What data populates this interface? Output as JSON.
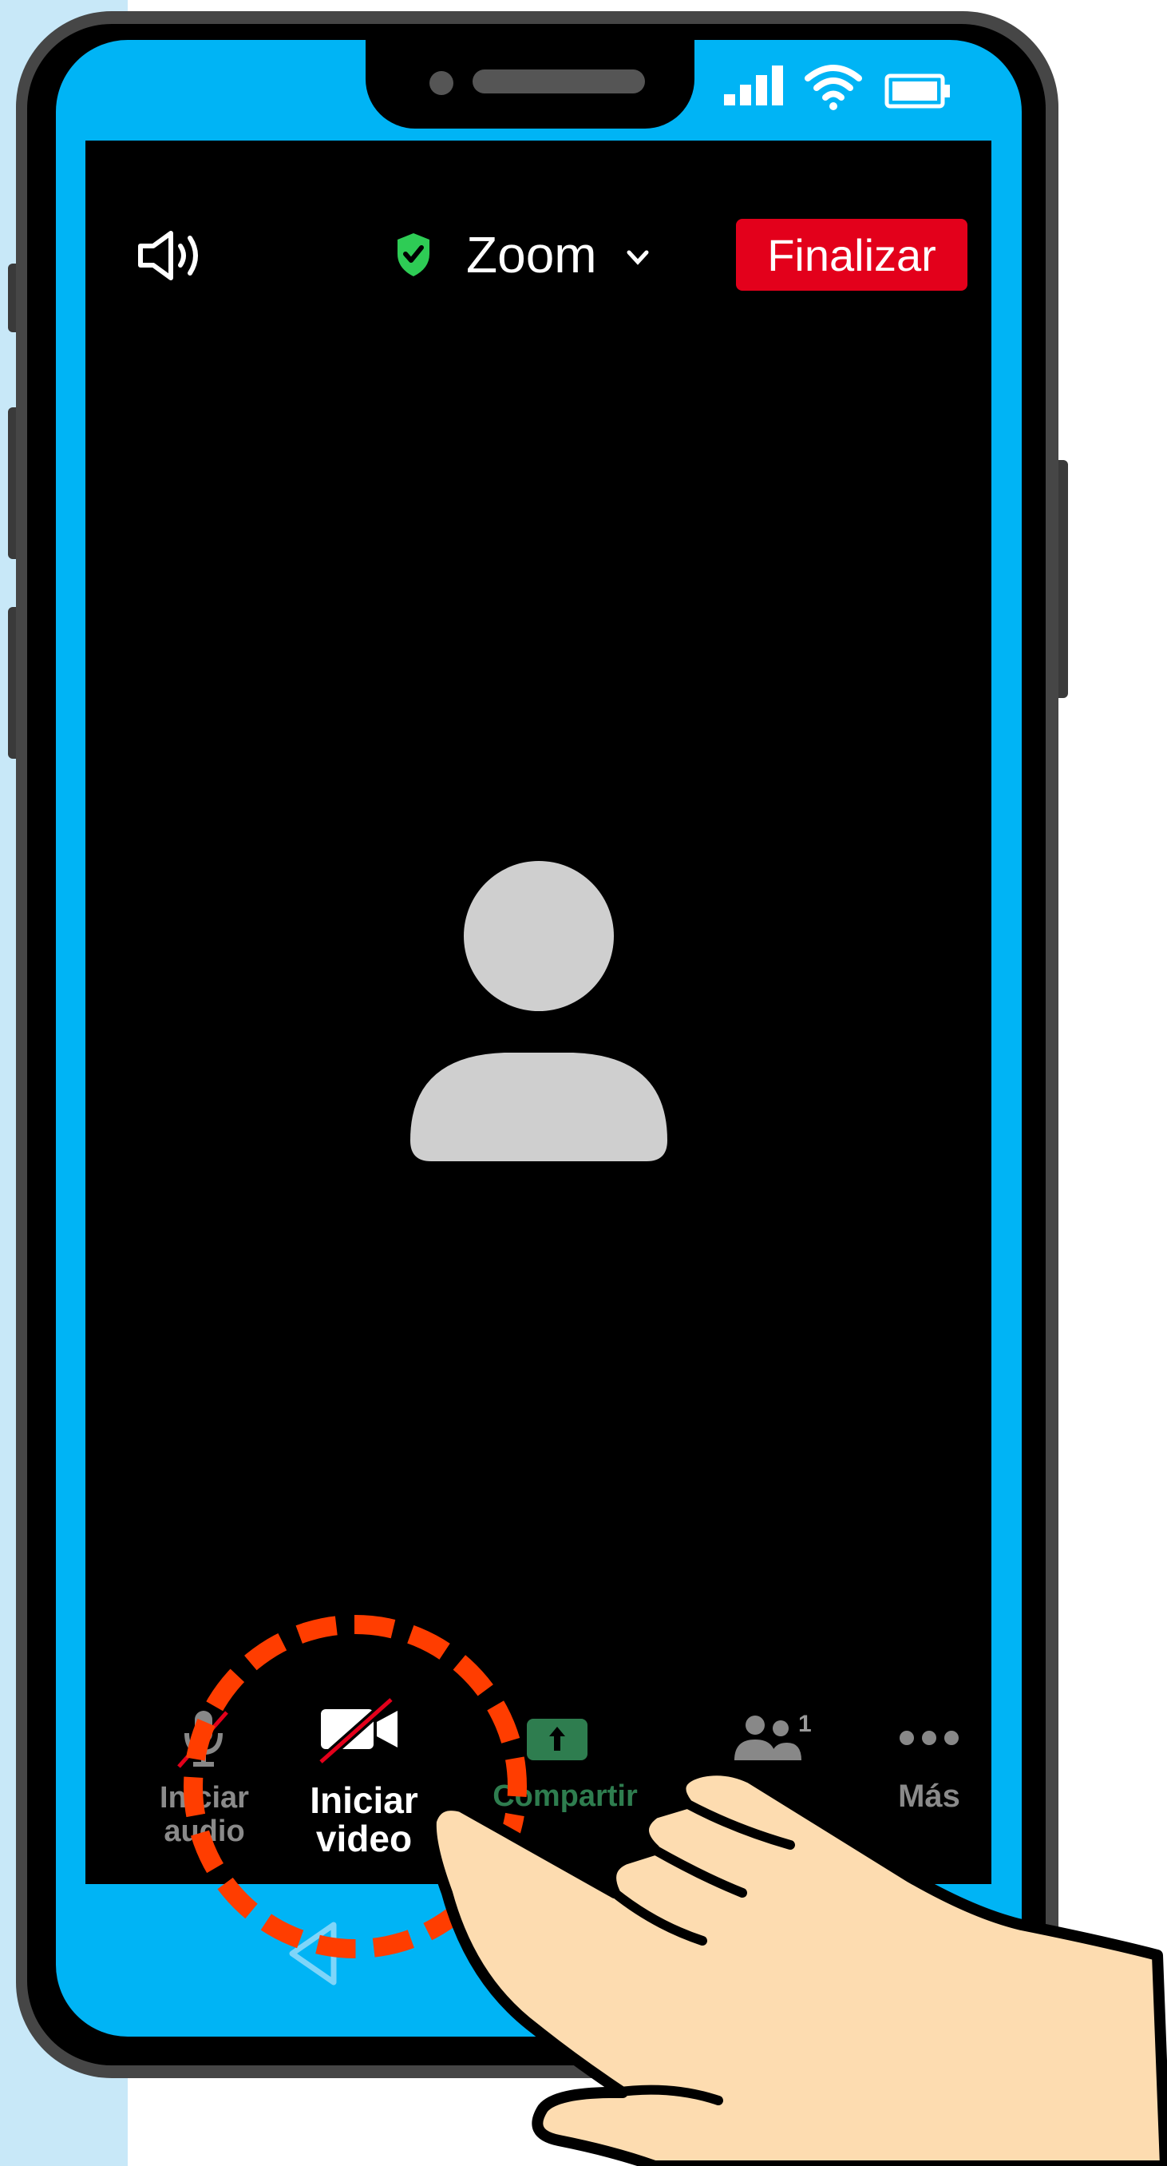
{
  "meeting_header": {
    "app_name": "Zoom",
    "end_button_label": "Finalizar",
    "speaker_icon": "speaker-icon",
    "security_icon": "shield-check-icon",
    "dropdown_icon": "chevron-down-icon"
  },
  "status_bar": {
    "icons": [
      "signal-icon",
      "wifi-icon",
      "battery-icon"
    ]
  },
  "main": {
    "placeholder_icon": "person-avatar-icon"
  },
  "toolbar": {
    "audio_label_line1": "Iniciar",
    "audio_label_line2": "audio",
    "video_label_line1": "Iniciar",
    "video_label_line2": "video",
    "share_label": "Compartir",
    "participants_count": "1",
    "more_label": "Más"
  },
  "colors": {
    "phone_frame": "#00b4f5",
    "end_button": "#e3001b",
    "share_green": "#2e7d4f",
    "highlight_ring": "#ff3d00",
    "hand_skin": "#fddcb0"
  }
}
